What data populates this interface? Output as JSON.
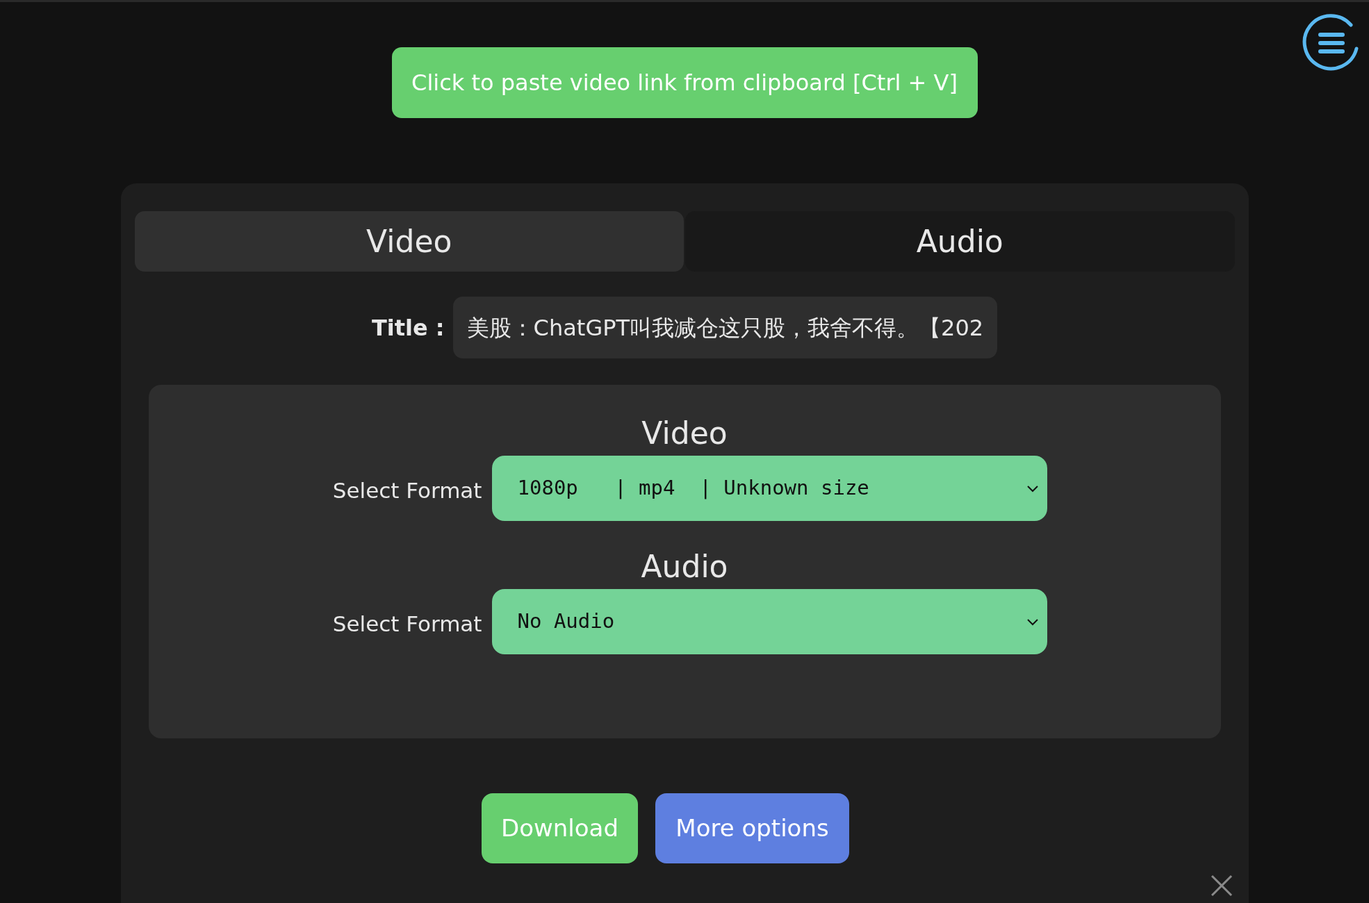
{
  "paste_button": {
    "label": "Click to paste video link from clipboard [Ctrl + V]"
  },
  "tabs": [
    {
      "label": "Video",
      "selected": true
    },
    {
      "label": "Audio",
      "selected": false
    }
  ],
  "title": {
    "label": "Title :",
    "value": "美股：ChatGPT叫我减仓这只股，我舍不得。【202"
  },
  "sections": [
    {
      "heading": "Video",
      "select_label": "Select Format",
      "value": "1080p   | mp4  | Unknown size"
    },
    {
      "heading": "Audio",
      "select_label": "Select Format",
      "value": "No Audio"
    }
  ],
  "buttons": [
    {
      "label": "Download",
      "kind": "primary"
    },
    {
      "label": "More options",
      "kind": "secondary"
    }
  ]
}
